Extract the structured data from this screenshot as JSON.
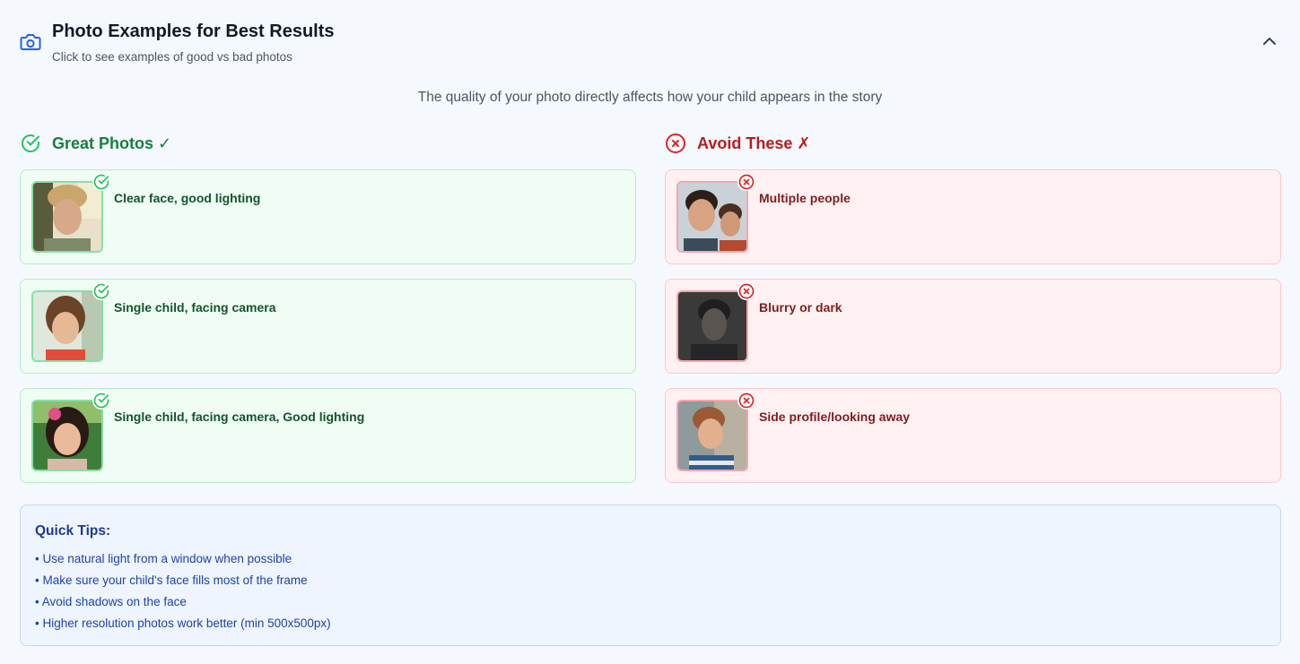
{
  "header": {
    "title": "Photo Examples for Best Results",
    "subtitle": "Click to see examples of good vs bad photos",
    "icon": "camera-icon",
    "collapse_icon": "chevron-up-icon"
  },
  "intro": "The quality of your photo directly affects how your child appears in the story",
  "good": {
    "heading": "Great Photos ✓",
    "icon": "check-circle-icon",
    "color": "#15803d",
    "items": [
      {
        "label": "Clear face, good lighting"
      },
      {
        "label": "Single child, facing camera"
      },
      {
        "label": "Single child, facing camera, Good lighting"
      }
    ]
  },
  "bad": {
    "heading": "Avoid These ✗",
    "icon": "x-circle-icon",
    "color": "#b91c1c",
    "items": [
      {
        "label": "Multiple people"
      },
      {
        "label": "Blurry or dark"
      },
      {
        "label": "Side profile/looking away"
      }
    ]
  },
  "tips": {
    "title": "Quick Tips:",
    "items": [
      "• Use natural light from a window when possible",
      "• Make sure your child's face fills most of the frame",
      "• Avoid shadows on the face",
      "• Higher resolution photos work better (min 500x500px)"
    ]
  }
}
